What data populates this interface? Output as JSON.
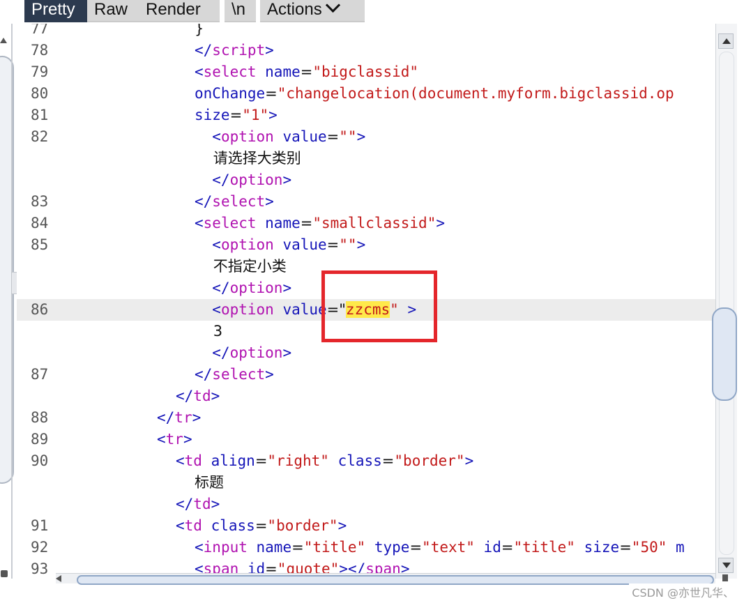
{
  "toolbar": {
    "tabs": [
      "Pretty",
      "Raw",
      "Render",
      "\\n"
    ],
    "actions_label": "Actions"
  },
  "lines": [
    {
      "n": "77",
      "code": [
        {
          "c": "txt",
          "v": "}"
        }
      ]
    },
    {
      "n": "78",
      "code": [
        {
          "c": "t",
          "v": "</"
        },
        {
          "c": "k",
          "v": "script"
        },
        {
          "c": "t",
          "v": ">"
        }
      ]
    },
    {
      "n": "79",
      "code": [
        {
          "c": "t",
          "v": "<"
        },
        {
          "c": "k",
          "v": "select"
        },
        {
          "c": "t",
          "v": " name"
        },
        {
          "c": "txt",
          "v": "="
        },
        {
          "c": "s",
          "v": "\"bigclassid\""
        }
      ]
    },
    {
      "n": "80",
      "code": [
        {
          "c": "t",
          "v": "onChange"
        },
        {
          "c": "txt",
          "v": "="
        },
        {
          "c": "s",
          "v": "\"changelocation(document.myform.bigclassid.op"
        }
      ]
    },
    {
      "n": "81",
      "code": [
        {
          "c": "t",
          "v": "size"
        },
        {
          "c": "txt",
          "v": "="
        },
        {
          "c": "s",
          "v": "\"1\""
        },
        {
          "c": "t",
          "v": ">"
        }
      ]
    },
    {
      "n": "82",
      "code": [
        {
          "c": "t",
          "v": "  <"
        },
        {
          "c": "k",
          "v": "option"
        },
        {
          "c": "t",
          "v": " value"
        },
        {
          "c": "txt",
          "v": "="
        },
        {
          "c": "s",
          "v": "\"\""
        },
        {
          "c": "t",
          "v": ">"
        }
      ]
    },
    {
      "n": "",
      "code": [
        {
          "c": "txt",
          "v": "    请选择大类别"
        }
      ]
    },
    {
      "n": "",
      "code": [
        {
          "c": "t",
          "v": "  </"
        },
        {
          "c": "k",
          "v": "option"
        },
        {
          "c": "t",
          "v": ">"
        }
      ]
    },
    {
      "n": "83",
      "code": [
        {
          "c": "t",
          "v": "</"
        },
        {
          "c": "k",
          "v": "select"
        },
        {
          "c": "t",
          "v": ">"
        }
      ]
    },
    {
      "n": "84",
      "code": [
        {
          "c": "t",
          "v": "<"
        },
        {
          "c": "k",
          "v": "select"
        },
        {
          "c": "t",
          "v": " name"
        },
        {
          "c": "txt",
          "v": "="
        },
        {
          "c": "s",
          "v": "\"smallclassid\""
        },
        {
          "c": "t",
          "v": ">"
        }
      ]
    },
    {
      "n": "85",
      "code": [
        {
          "c": "t",
          "v": "  <"
        },
        {
          "c": "k",
          "v": "option"
        },
        {
          "c": "t",
          "v": " value"
        },
        {
          "c": "txt",
          "v": "="
        },
        {
          "c": "s",
          "v": "\"\""
        },
        {
          "c": "t",
          "v": ">"
        }
      ]
    },
    {
      "n": "",
      "code": [
        {
          "c": "txt",
          "v": "    不指定小类"
        }
      ]
    },
    {
      "n": "",
      "code": [
        {
          "c": "t",
          "v": "  </"
        },
        {
          "c": "k",
          "v": "option"
        },
        {
          "c": "t",
          "v": ">"
        }
      ]
    },
    {
      "n": "86",
      "hl": true,
      "code": [
        {
          "c": "t",
          "v": "  <"
        },
        {
          "c": "k",
          "v": "option"
        },
        {
          "c": "t",
          "v": " value"
        },
        {
          "c": "txt",
          "v": "=\""
        },
        {
          "c": "mark",
          "v": "zzcms"
        },
        {
          "c": "s",
          "v": "\""
        },
        {
          "c": "t",
          "v": " >"
        }
      ]
    },
    {
      "n": "",
      "code": [
        {
          "c": "txt",
          "v": "    3"
        }
      ]
    },
    {
      "n": "",
      "code": [
        {
          "c": "t",
          "v": "  </"
        },
        {
          "c": "k",
          "v": "option"
        },
        {
          "c": "t",
          "v": ">"
        }
      ]
    },
    {
      "n": "87",
      "code": [
        {
          "c": "t",
          "v": "</"
        },
        {
          "c": "k",
          "v": "select"
        },
        {
          "c": "t",
          "v": ">"
        }
      ]
    },
    {
      "n": "",
      "indent": -1,
      "code": [
        {
          "c": "t",
          "v": "</"
        },
        {
          "c": "k",
          "v": "td"
        },
        {
          "c": "t",
          "v": ">"
        }
      ]
    },
    {
      "n": "88",
      "indent": -2,
      "code": [
        {
          "c": "t",
          "v": "</"
        },
        {
          "c": "k",
          "v": "tr"
        },
        {
          "c": "t",
          "v": ">"
        }
      ]
    },
    {
      "n": "89",
      "indent": -2,
      "code": [
        {
          "c": "t",
          "v": "<"
        },
        {
          "c": "k",
          "v": "tr"
        },
        {
          "c": "t",
          "v": ">"
        }
      ]
    },
    {
      "n": "90",
      "indent": -1,
      "code": [
        {
          "c": "t",
          "v": "<"
        },
        {
          "c": "k",
          "v": "td"
        },
        {
          "c": "t",
          "v": " align"
        },
        {
          "c": "txt",
          "v": "="
        },
        {
          "c": "s",
          "v": "\"right\""
        },
        {
          "c": "t",
          "v": " class"
        },
        {
          "c": "txt",
          "v": "="
        },
        {
          "c": "s",
          "v": "\"border\""
        },
        {
          "c": "t",
          "v": ">"
        }
      ]
    },
    {
      "n": "",
      "code": [
        {
          "c": "txt",
          "v": "标题"
        }
      ]
    },
    {
      "n": "",
      "indent": -1,
      "code": [
        {
          "c": "t",
          "v": "</"
        },
        {
          "c": "k",
          "v": "td"
        },
        {
          "c": "t",
          "v": ">"
        }
      ]
    },
    {
      "n": "91",
      "indent": -1,
      "code": [
        {
          "c": "t",
          "v": "<"
        },
        {
          "c": "k",
          "v": "td"
        },
        {
          "c": "t",
          "v": " class"
        },
        {
          "c": "txt",
          "v": "="
        },
        {
          "c": "s",
          "v": "\"border\""
        },
        {
          "c": "t",
          "v": ">"
        }
      ]
    },
    {
      "n": "92",
      "code": [
        {
          "c": "t",
          "v": "<"
        },
        {
          "c": "k",
          "v": "input"
        },
        {
          "c": "t",
          "v": " name"
        },
        {
          "c": "txt",
          "v": "="
        },
        {
          "c": "s",
          "v": "\"title\""
        },
        {
          "c": "t",
          "v": " type"
        },
        {
          "c": "txt",
          "v": "="
        },
        {
          "c": "s",
          "v": "\"text\""
        },
        {
          "c": "t",
          "v": " id"
        },
        {
          "c": "txt",
          "v": "="
        },
        {
          "c": "s",
          "v": "\"title\""
        },
        {
          "c": "t",
          "v": " size"
        },
        {
          "c": "txt",
          "v": "="
        },
        {
          "c": "s",
          "v": "\"50\""
        },
        {
          "c": "t",
          "v": " m"
        }
      ]
    },
    {
      "n": "93",
      "code": [
        {
          "c": "t",
          "v": "<"
        },
        {
          "c": "k",
          "v": "span"
        },
        {
          "c": "t",
          "v": " id"
        },
        {
          "c": "txt",
          "v": "="
        },
        {
          "c": "s",
          "v": "\"quote\""
        },
        {
          "c": "t",
          "v": "></"
        },
        {
          "c": "k",
          "v": "span"
        },
        {
          "c": "t",
          "v": ">"
        }
      ]
    }
  ],
  "watermark": "CSDN @亦世凡华、"
}
